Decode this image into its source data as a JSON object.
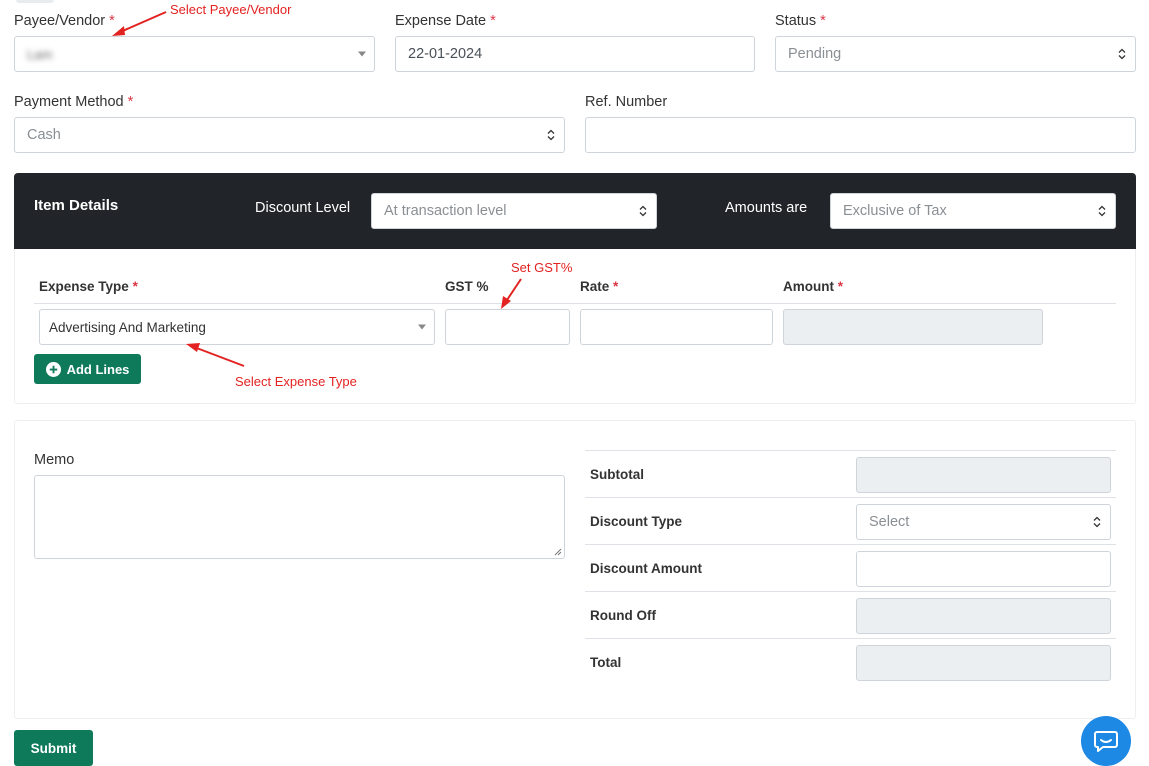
{
  "form": {
    "payee": {
      "label": "Payee/Vendor",
      "value": "Lam"
    },
    "expense_date": {
      "label": "Expense Date",
      "value": "22-01-2024"
    },
    "status": {
      "label": "Status",
      "value": "Pending"
    },
    "payment_method": {
      "label": "Payment Method",
      "value": "Cash"
    },
    "ref_number": {
      "label": "Ref. Number",
      "value": ""
    },
    "required_mark": "*"
  },
  "item_details": {
    "title": "Item Details",
    "discount_level_label": "Discount Level",
    "discount_level_value": "At transaction level",
    "amounts_are_label": "Amounts are",
    "amounts_are_value": "Exclusive of Tax",
    "columns": [
      "Expense Type",
      "GST %",
      "Rate",
      "Amount"
    ],
    "row": {
      "expense_type": "Advertising And Marketing",
      "gst": "",
      "rate": "",
      "amount": ""
    },
    "add_lines_label": "Add Lines"
  },
  "annotations": {
    "select_payee": "Select Payee/Vendor",
    "set_gst": "Set GST%",
    "select_expense_type": "Select Expense Type"
  },
  "memo": {
    "label": "Memo",
    "value": ""
  },
  "summary": {
    "subtotal": "Subtotal",
    "discount_type": "Discount Type",
    "discount_type_placeholder": "Select",
    "discount_amount": "Discount Amount",
    "round_off": "Round Off",
    "total": "Total"
  },
  "submit_label": "Submit",
  "colors": {
    "primary_green": "#0f7a5a",
    "dark_header": "#212529",
    "annotation_red": "#e32222",
    "chat_blue": "#1e88e5"
  },
  "icons": {
    "chat": "chat-bubble-icon",
    "add": "plus-circle-icon"
  }
}
